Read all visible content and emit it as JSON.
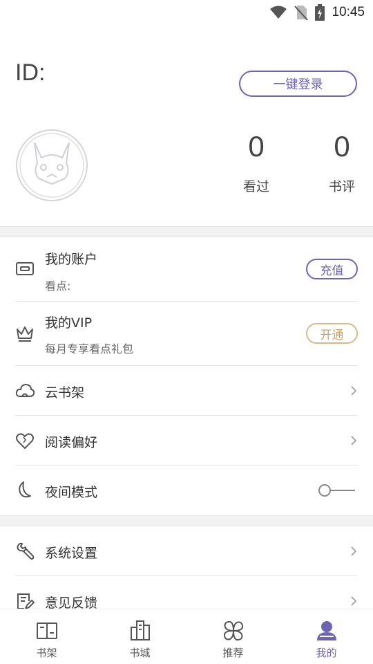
{
  "status": {
    "time": "10:45"
  },
  "profile": {
    "id_label": "ID:",
    "login_button": "一键登录",
    "stats": [
      {
        "value": "0",
        "label": "看过"
      },
      {
        "value": "0",
        "label": "书评"
      }
    ]
  },
  "menu": {
    "account": {
      "title": "我的账户",
      "subtitle": "看点:",
      "action": "充值"
    },
    "vip": {
      "title": "我的VIP",
      "subtitle": "每月专享看点礼包",
      "action": "开通"
    },
    "cloud_shelf": {
      "title": "云书架"
    },
    "reading_pref": {
      "title": "阅读偏好"
    },
    "night_mode": {
      "title": "夜间模式",
      "enabled": false
    },
    "settings": {
      "title": "系统设置"
    },
    "feedback": {
      "title": "意见反馈"
    }
  },
  "nav": {
    "items": [
      {
        "label": "书架",
        "icon": "bookshelf-icon"
      },
      {
        "label": "书城",
        "icon": "bookstore-icon"
      },
      {
        "label": "推荐",
        "icon": "recommend-icon"
      },
      {
        "label": "我的",
        "icon": "profile-icon",
        "active": true
      }
    ]
  },
  "colors": {
    "accent": "#6e64b4",
    "vip": "#c9a36b",
    "divider": "#e3e3e3"
  }
}
